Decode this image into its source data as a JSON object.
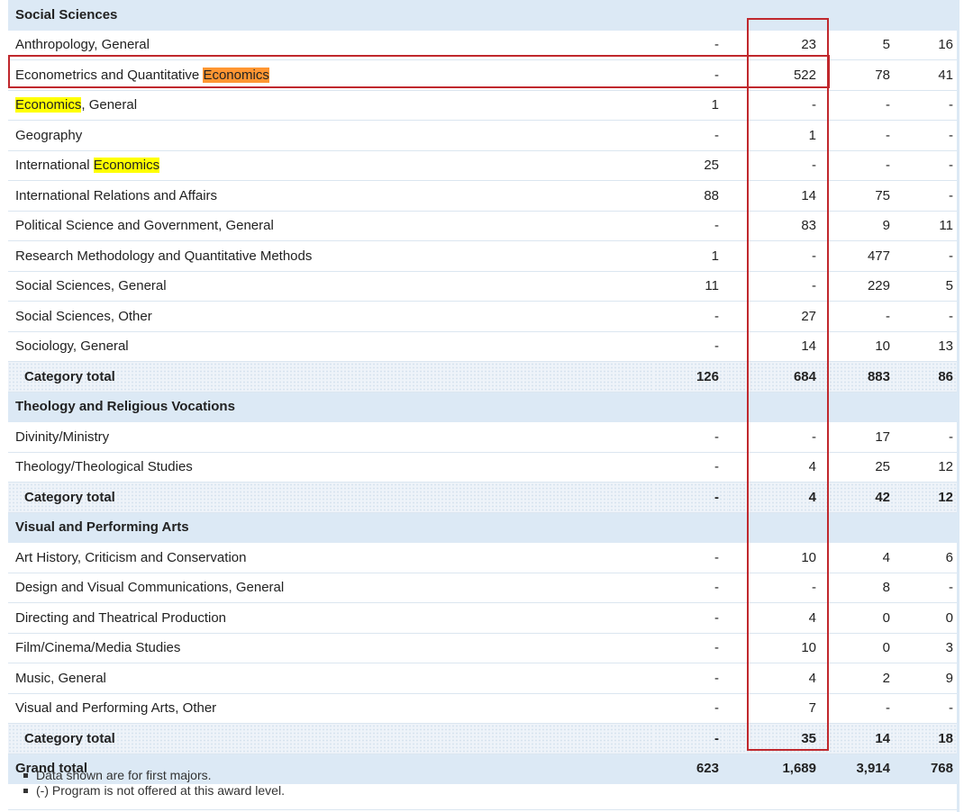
{
  "sections": [
    {
      "title": "Social Sciences",
      "rows": [
        {
          "name": "Anthropology, General",
          "v": [
            "-",
            "23",
            "5",
            "16"
          ]
        },
        {
          "name": "Econometrics and Quantitative ",
          "hl": "Economics",
          "hl_style": "active",
          "v": [
            "-",
            "522",
            "78",
            "41"
          ]
        },
        {
          "name": ", General",
          "hl_prefix": "Economics",
          "v": [
            "1",
            "-",
            "-",
            "-"
          ]
        },
        {
          "name": "Geography",
          "v": [
            "-",
            "1",
            "-",
            "-"
          ]
        },
        {
          "name": "International ",
          "hl": "Economics",
          "v": [
            "25",
            "-",
            "-",
            "-"
          ]
        },
        {
          "name": "International Relations and Affairs",
          "v": [
            "88",
            "14",
            "75",
            "-"
          ]
        },
        {
          "name": "Political Science and Government, General",
          "v": [
            "-",
            "83",
            "9",
            "11"
          ]
        },
        {
          "name": "Research Methodology and Quantitative Methods",
          "v": [
            "1",
            "-",
            "477",
            "-"
          ]
        },
        {
          "name": "Social Sciences, General",
          "v": [
            "11",
            "-",
            "229",
            "5"
          ]
        },
        {
          "name": "Social Sciences, Other",
          "v": [
            "-",
            "27",
            "-",
            "-"
          ]
        },
        {
          "name": "Sociology, General",
          "v": [
            "-",
            "14",
            "10",
            "13"
          ]
        }
      ],
      "total": {
        "label": "Category total",
        "v": [
          "126",
          "684",
          "883",
          "86"
        ]
      }
    },
    {
      "title": "Theology and Religious Vocations",
      "rows": [
        {
          "name": "Divinity/Ministry",
          "v": [
            "-",
            "-",
            "17",
            "-"
          ]
        },
        {
          "name": "Theology/Theological Studies",
          "v": [
            "-",
            "4",
            "25",
            "12"
          ]
        }
      ],
      "total": {
        "label": "Category total",
        "v": [
          "-",
          "4",
          "42",
          "12"
        ]
      }
    },
    {
      "title": "Visual and Performing Arts",
      "rows": [
        {
          "name": "Art History, Criticism and Conservation",
          "v": [
            "-",
            "10",
            "4",
            "6"
          ]
        },
        {
          "name": "Design and Visual Communications, General",
          "v": [
            "-",
            "-",
            "8",
            "-"
          ]
        },
        {
          "name": "Directing and Theatrical Production",
          "v": [
            "-",
            "4",
            "0",
            "0"
          ]
        },
        {
          "name": "Film/Cinema/Media Studies",
          "v": [
            "-",
            "10",
            "0",
            "3"
          ]
        },
        {
          "name": "Music, General",
          "v": [
            "-",
            "4",
            "2",
            "9"
          ]
        },
        {
          "name": "Visual and Performing Arts, Other",
          "v": [
            "-",
            "7",
            "-",
            "-"
          ]
        }
      ],
      "total": {
        "label": "Category total",
        "v": [
          "-",
          "35",
          "14",
          "18"
        ]
      }
    }
  ],
  "grand_total": {
    "label": "Grand total",
    "v": [
      "623",
      "1,689",
      "3,914",
      "768"
    ]
  },
  "notes": [
    "Data shown are for first majors.",
    "(-) Program is not offered at this award level."
  ],
  "colors": {
    "header_bg": "#dce9f5",
    "highlight": "#ffff00",
    "highlight_active": "#ff9632",
    "annotation_box": "#c0282d"
  }
}
